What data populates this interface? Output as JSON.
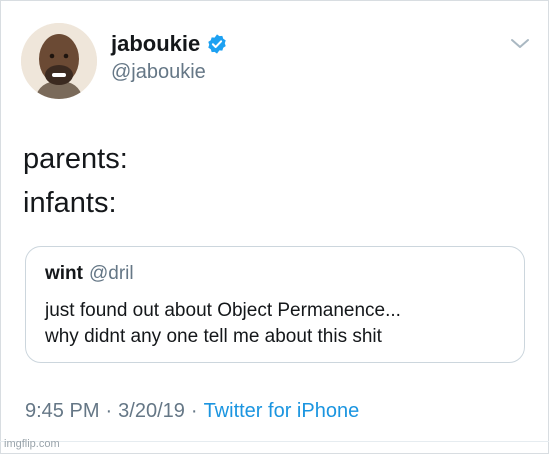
{
  "author": {
    "display_name": "jaboukie",
    "handle": "@jaboukie",
    "verified": true
  },
  "icons": {
    "verified": "verified-badge-icon",
    "menu": "chevron-down-icon"
  },
  "tweet": {
    "lines": [
      "parents:",
      "infants:"
    ]
  },
  "quoted_tweet": {
    "display_name": "wint",
    "handle": "@dril",
    "lines": [
      "just found out about Object Permanence...",
      "why didnt any one tell me about this shit"
    ]
  },
  "meta": {
    "time": "9:45 PM",
    "separator": "·",
    "date": "3/20/19",
    "source": "Twitter for iPhone"
  },
  "watermark": "imgflip.com",
  "colors": {
    "text": "#14171a",
    "secondary": "#657786",
    "link": "#1b95e0",
    "verified": "#1da1f2",
    "border": "#ccd6dd"
  }
}
